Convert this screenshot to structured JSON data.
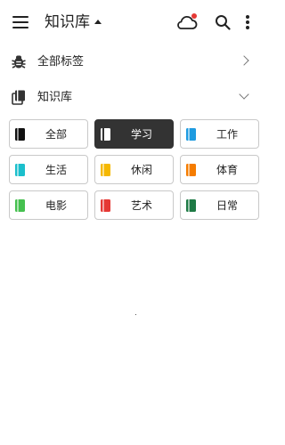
{
  "appbar": {
    "title": "知识库",
    "icons": [
      "menu-icon",
      "caret-up-icon",
      "cloud-sync-icon",
      "search-icon",
      "more-vert-icon"
    ],
    "notification_dot_color": "#e53935"
  },
  "all_tags": {
    "label": "全部标签",
    "icon": "bug-icon"
  },
  "knowledge_base": {
    "label": "知识库",
    "icon": "notebooks-icon"
  },
  "categories": [
    {
      "label": "全部",
      "color": "#111111",
      "selected": false
    },
    {
      "label": "学习",
      "color": "#ffffff",
      "selected": true
    },
    {
      "label": "工作",
      "color": "#1e9be0",
      "selected": false
    },
    {
      "label": "生活",
      "color": "#1bbfcc",
      "selected": false
    },
    {
      "label": "休闲",
      "color": "#f5b800",
      "selected": false
    },
    {
      "label": "体育",
      "color": "#f57c00",
      "selected": false
    },
    {
      "label": "电影",
      "color": "#45c04f",
      "selected": false
    },
    {
      "label": "艺术",
      "color": "#e53935",
      "selected": false
    },
    {
      "label": "日常",
      "color": "#1e7a45",
      "selected": false
    }
  ]
}
